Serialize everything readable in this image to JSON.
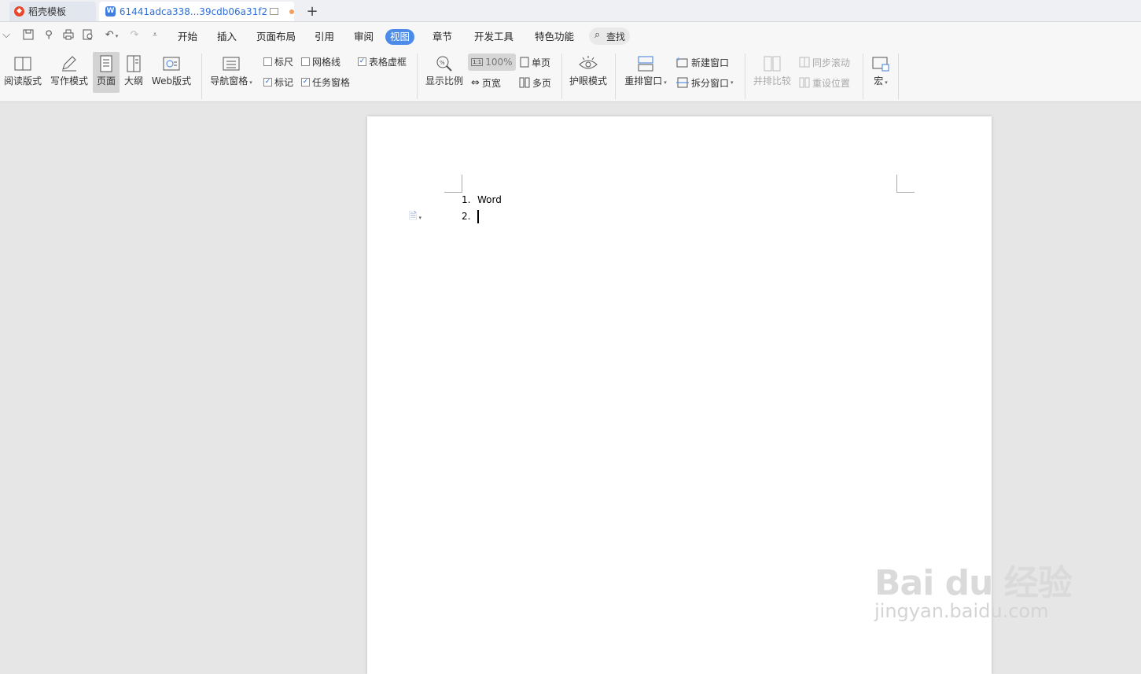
{
  "tabs": [
    {
      "label": "稻壳模板",
      "icon": "daoke-flame-icon"
    },
    {
      "label": "61441adca338...39cdb06a31f2",
      "icon": "wps-writer-doc-icon"
    }
  ],
  "menu": {
    "items": [
      "开始",
      "插入",
      "页面布局",
      "引用",
      "审阅",
      "视图",
      "章节",
      "开发工具",
      "特色功能"
    ],
    "active": "视图",
    "search_label": "查找"
  },
  "ribbon": {
    "view_modes": [
      "阅读版式",
      "写作模式",
      "页面",
      "大纲",
      "Web版式"
    ],
    "nav_pane": "导航窗格",
    "checkboxes": {
      "ruler": {
        "label": "标尺",
        "checked": false
      },
      "gridlines": {
        "label": "网格线",
        "checked": false
      },
      "table_gridlines": {
        "label": "表格虚框",
        "checked": true
      },
      "marks": {
        "label": "标记",
        "checked": true
      },
      "task_pane": {
        "label": "任务窗格",
        "checked": true
      }
    },
    "zoom": {
      "label": "显示比例",
      "value": "100%",
      "page_width": "页宽",
      "single_page": "单页",
      "multi_page": "多页"
    },
    "eye_mode": "护眼模式",
    "window": {
      "arrange": "重排窗口",
      "new_window": "新建窗口",
      "split_window": "拆分窗口"
    },
    "compare": {
      "side_by_side": "并排比较",
      "sync_scroll": "同步滚动",
      "reset_position": "重设位置"
    },
    "macro": "宏"
  },
  "document": {
    "list_items": [
      {
        "number": "1.",
        "text": "Word"
      },
      {
        "number": "2.",
        "text": ""
      }
    ]
  },
  "watermark": {
    "logo": "Bai du 经验",
    "url": "jingyan.baidu.com"
  },
  "colors": {
    "accent": "#4c8be8",
    "tab_text": "#2f6fd6"
  }
}
